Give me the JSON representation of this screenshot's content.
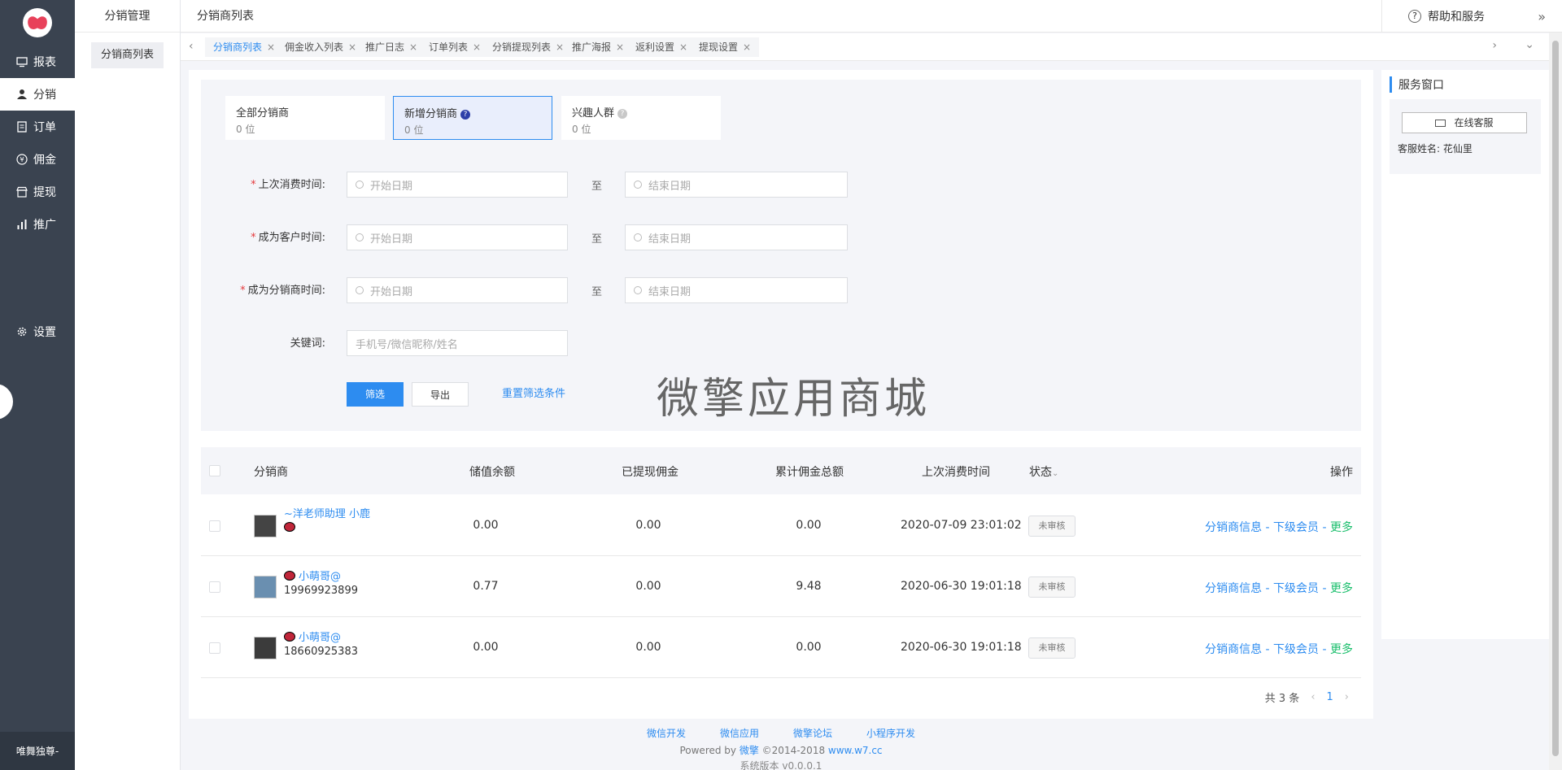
{
  "sidebar": {
    "items": [
      {
        "label": "报表",
        "icon": "monitor-icon"
      },
      {
        "label": "分销",
        "icon": "user-icon"
      },
      {
        "label": "订单",
        "icon": "document-icon"
      },
      {
        "label": "佣金",
        "icon": "yen-icon"
      },
      {
        "label": "提现",
        "icon": "store-icon"
      },
      {
        "label": "推广",
        "icon": "bar-chart-icon"
      },
      {
        "label": "设置",
        "icon": "gear-icon"
      }
    ],
    "bottom_label": "唯舞独尊-"
  },
  "subside": {
    "title": "分销管理",
    "items": [
      "分销商列表"
    ]
  },
  "topbar": {
    "title": "分销商列表",
    "help_label": "帮助和服务"
  },
  "tabs": [
    "分销商列表",
    "佣金收入列表",
    "推广日志",
    "订单列表",
    "分销提现列表",
    "推广海报",
    "返利设置",
    "提现设置"
  ],
  "cards": [
    {
      "title": "全部分销商",
      "count": "0 位"
    },
    {
      "title": "新增分销商",
      "count": "0 位"
    },
    {
      "title": "兴趣人群",
      "count": "0 位"
    }
  ],
  "filters": {
    "last_consume_label": "上次消费时间:",
    "become_customer_label": "成为客户时间:",
    "become_distributor_label": "成为分销商时间:",
    "keyword_label": "关键词:",
    "start_placeholder": "开始日期",
    "end_placeholder": "结束日期",
    "to_label": "至",
    "keyword_placeholder": "手机号/微信昵称/姓名",
    "filter_btn": "筛选",
    "export_btn": "导出",
    "reset_link": "重置筛选条件"
  },
  "watermark": "微擎应用商城",
  "table": {
    "headers": {
      "distributor": "分销商",
      "balance": "储值余额",
      "withdrawn": "已提现佣金",
      "total": "累计佣金总额",
      "last_time": "上次消费时间",
      "status": "状态",
      "ops": "操作"
    },
    "rows": [
      {
        "name": "~洋老师助理",
        "sub": "小鹿",
        "balance": "0.00",
        "withdrawn": "0.00",
        "total": "0.00",
        "last_time": "2020-07-09 23:01:02",
        "status": "未审核"
      },
      {
        "name": "小萌哥@",
        "sub": "19969923899",
        "balance": "0.77",
        "withdrawn": "0.00",
        "total": "9.48",
        "last_time": "2020-06-30 19:01:18",
        "status": "未审核"
      },
      {
        "name": "小萌哥@",
        "sub": "18660925383",
        "balance": "0.00",
        "withdrawn": "0.00",
        "total": "0.00",
        "last_time": "2020-06-30 19:01:18",
        "status": "未审核"
      }
    ],
    "op_info": "分销商信息",
    "op_sub": "下级会员",
    "op_more": "更多",
    "sep": " - "
  },
  "pager": {
    "total": "共 3 条",
    "page": "1"
  },
  "service": {
    "title": "服务窗口",
    "online_btn": "在线客服",
    "kf_name": "客服姓名: 花仙里"
  },
  "footer": {
    "links": [
      "微信开发",
      "微信应用",
      "微擎论坛",
      "小程序开发"
    ],
    "powered_prefix": "Powered by ",
    "powered_brand": "微擎",
    "copyright": " ©2014-2018 ",
    "site": "www.w7.cc",
    "version": "系统版本 v0.0.0.1"
  },
  "colors": {
    "sidebar": "#3a4350",
    "accent": "#2d8cf0",
    "more": "#19be6b"
  }
}
